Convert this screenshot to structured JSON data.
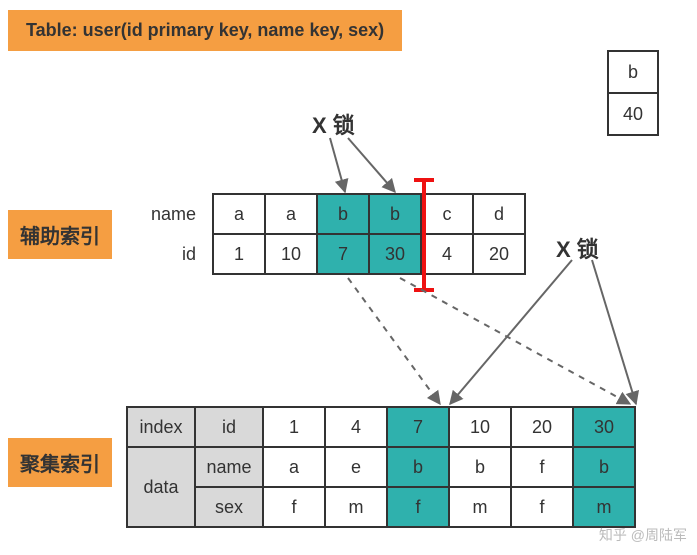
{
  "title": "Table: user(id primary key, name key, sex)",
  "topSmall": {
    "r0": "b",
    "r1": "40"
  },
  "xlock1": "X 锁",
  "xlock2": "X 锁",
  "labels": {
    "aux": "辅助索引",
    "cluster": "聚集索引"
  },
  "aux": {
    "rowLabels": {
      "name": "name",
      "id": "id"
    },
    "nameRow": [
      "a",
      "a",
      "b",
      "b",
      "c",
      "d"
    ],
    "idRow": [
      "1",
      "10",
      "7",
      "30",
      "4",
      "20"
    ],
    "highlightCols": [
      2,
      3
    ]
  },
  "cluster": {
    "leftLabels": {
      "index": "index",
      "data": "data"
    },
    "colHdr": "id",
    "rowHdrs": {
      "name": "name",
      "sex": "sex"
    },
    "idRow": [
      "1",
      "4",
      "7",
      "10",
      "20",
      "30"
    ],
    "nameRow": [
      "a",
      "e",
      "b",
      "b",
      "f",
      "b"
    ],
    "sexRow": [
      "f",
      "m",
      "f",
      "m",
      "f",
      "m"
    ],
    "highlightCols": [
      2,
      5
    ]
  },
  "watermark": "知乎 @周陆军"
}
